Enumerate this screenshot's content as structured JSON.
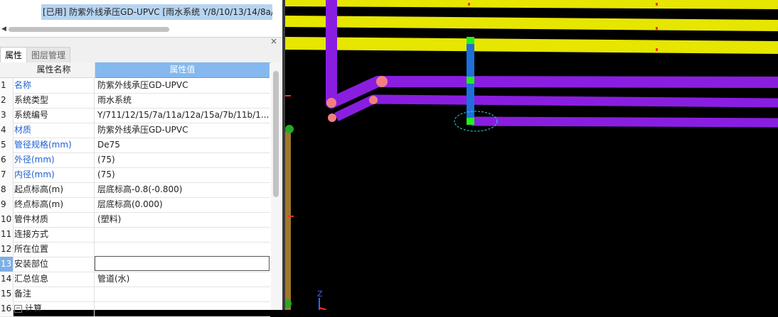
{
  "selection_text": "[已用] 防紫外线承压GD-UPVC [雨水系统 Y/8/10/13/14/8a/",
  "tabs": [
    "属性",
    "图层管理"
  ],
  "grid": {
    "header_name": "属性名称",
    "header_value": "属性值",
    "rows": [
      {
        "idx": "1",
        "name": "名称",
        "value": "防紫外线承压GD-UPVC"
      },
      {
        "idx": "2",
        "name": "系统类型",
        "value": "雨水系统"
      },
      {
        "idx": "3",
        "name": "系统编号",
        "value": "Y/711/12/15/7a/11a/12a/15a/7b/11b/1..."
      },
      {
        "idx": "4",
        "name": "材质",
        "value": "防紫外线承压GD-UPVC"
      },
      {
        "idx": "5",
        "name": "管径规格(mm)",
        "value": "De75"
      },
      {
        "idx": "6",
        "name": "外径(mm)",
        "value": "(75)"
      },
      {
        "idx": "7",
        "name": "内径(mm)",
        "value": "(75)"
      },
      {
        "idx": "8",
        "name": "起点标高(m)",
        "value": "层底标高-0.8(-0.800)"
      },
      {
        "idx": "9",
        "name": "终点标高(m)",
        "value": "层底标高(0.000)"
      },
      {
        "idx": "10",
        "name": "管件材质",
        "value": "(塑料)"
      },
      {
        "idx": "11",
        "name": "连接方式",
        "value": ""
      },
      {
        "idx": "12",
        "name": "所在位置",
        "value": ""
      },
      {
        "idx": "13",
        "name": "安装部位",
        "value": ""
      },
      {
        "idx": "14",
        "name": "汇总信息",
        "value": "管道(水)"
      },
      {
        "idx": "15",
        "name": "备注",
        "value": ""
      },
      {
        "idx": "16",
        "name": "计算",
        "value": ""
      }
    ]
  },
  "expander_symbol": "−",
  "close_symbol": "×",
  "scroll_left_symbol": "◀",
  "axis_label": "Z",
  "colors": {
    "pipe_purple": "#8a1ee0",
    "pipe_yellow": "#e6e600",
    "riser_blue": "#1e6fd9",
    "node_green": "#22ee22",
    "accent_blue": "#84b8ee"
  }
}
